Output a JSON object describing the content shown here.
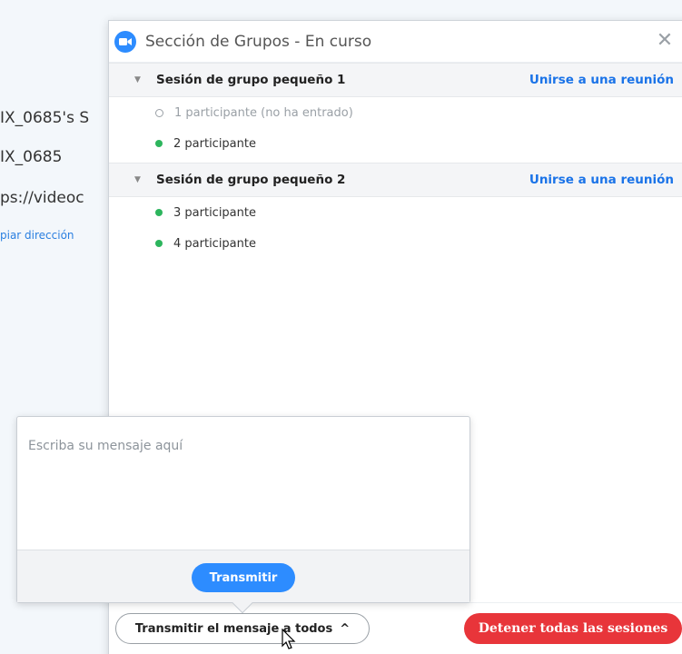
{
  "background": {
    "lines": [
      "IX_0685's S",
      "IX_0685",
      "ps://videoc"
    ],
    "copy_link": "piar dirección"
  },
  "dialog": {
    "title": "Sección de Grupos - En curso",
    "close_icon": "close-icon",
    "groups": [
      {
        "name": "Sesión de grupo pequeño 1",
        "join_label": "Unirse a una reunión",
        "participants": [
          {
            "label": "1 participante (no ha entrado)",
            "status": "pending"
          },
          {
            "label": "2 participante",
            "status": "joined"
          }
        ]
      },
      {
        "name": "Sesión de grupo pequeño 2",
        "join_label": "Unirse a una reunión",
        "participants": [
          {
            "label": "3 participante",
            "status": "joined"
          },
          {
            "label": "4 participante",
            "status": "joined"
          }
        ]
      }
    ]
  },
  "broadcast_popup": {
    "placeholder": "Escriba su mensaje aquí",
    "transmit_label": "Transmitir"
  },
  "footer": {
    "broadcast_label": "Transmitir el mensaje a todos",
    "stop_label": "Detener todas las sesiones"
  },
  "colors": {
    "accent": "#2d8cff",
    "link": "#1a73e8",
    "danger": "#e8353a",
    "online": "#2db55d"
  }
}
